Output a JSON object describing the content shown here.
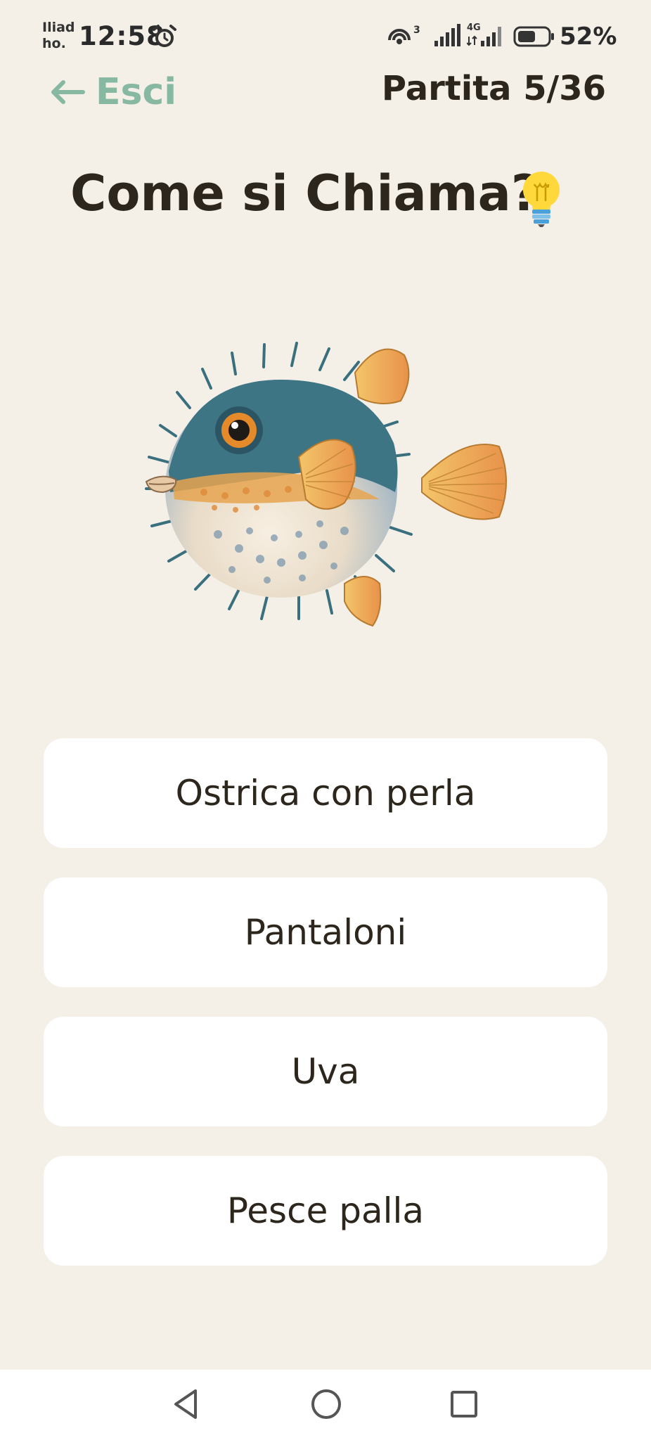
{
  "status_bar": {
    "carrier_line1": "Iliad",
    "carrier_line2": "ho.",
    "time": "12:58",
    "network_type": "4G",
    "hotspot_count": "3",
    "battery_percent": "52%",
    "icons": [
      "alarm-icon",
      "hotspot-icon",
      "signal-icon",
      "signal-4g-icon",
      "battery-icon"
    ]
  },
  "header": {
    "exit_label": "Esci",
    "progress": "Partita 5/36"
  },
  "question": {
    "title": "Come si Chiama?",
    "hint_icon": "lightbulb-icon",
    "image_subject": "pufferfish"
  },
  "answers": [
    {
      "label": "Ostrica con perla"
    },
    {
      "label": "Pantaloni"
    },
    {
      "label": "Uva"
    },
    {
      "label": "Pesce palla"
    }
  ],
  "colors": {
    "background": "#f4f0e8",
    "accent": "#86b8a2",
    "text": "#2c261c",
    "card": "#ffffff"
  },
  "nav_bar": {
    "icons": [
      "nav-back-icon",
      "nav-home-icon",
      "nav-recents-icon"
    ]
  }
}
